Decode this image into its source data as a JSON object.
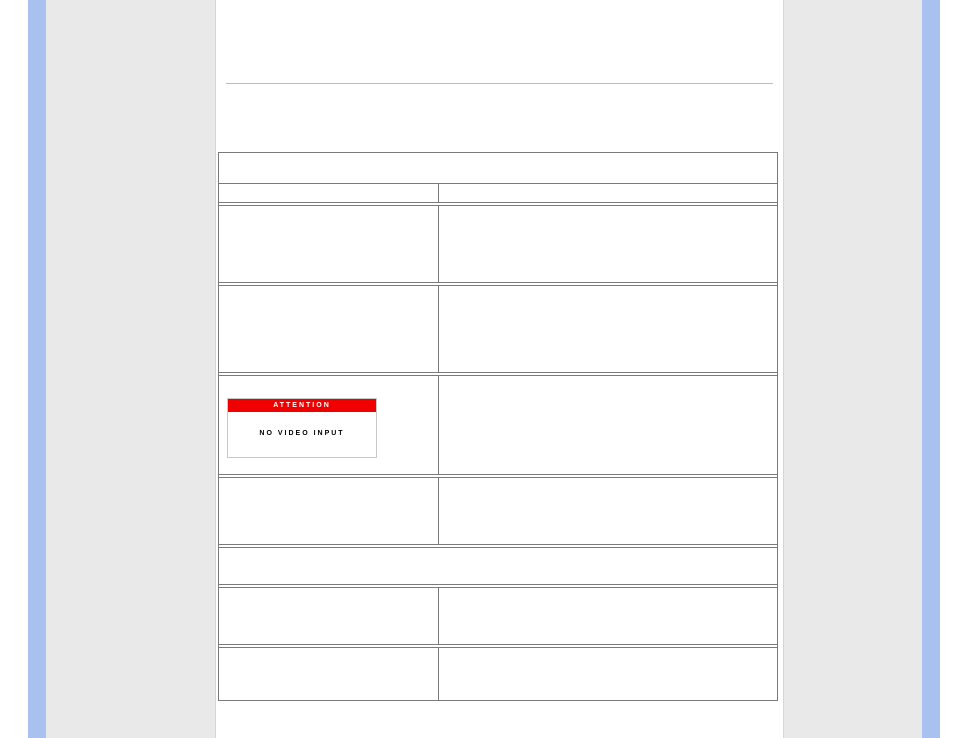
{
  "osd": {
    "title": "ATTENTION",
    "message": "NO VIDEO INPUT"
  },
  "table": {
    "header": "",
    "col_left_header": "",
    "col_right_header": "",
    "rows": [
      {
        "left": "",
        "right": ""
      },
      {
        "left": "",
        "right": ""
      },
      {
        "left_has_osd": true,
        "right": ""
      },
      {
        "left": "",
        "right": ""
      }
    ],
    "section2_header": "",
    "section2_rows": [
      {
        "left": "",
        "right": ""
      },
      {
        "left": "",
        "right": ""
      }
    ]
  }
}
